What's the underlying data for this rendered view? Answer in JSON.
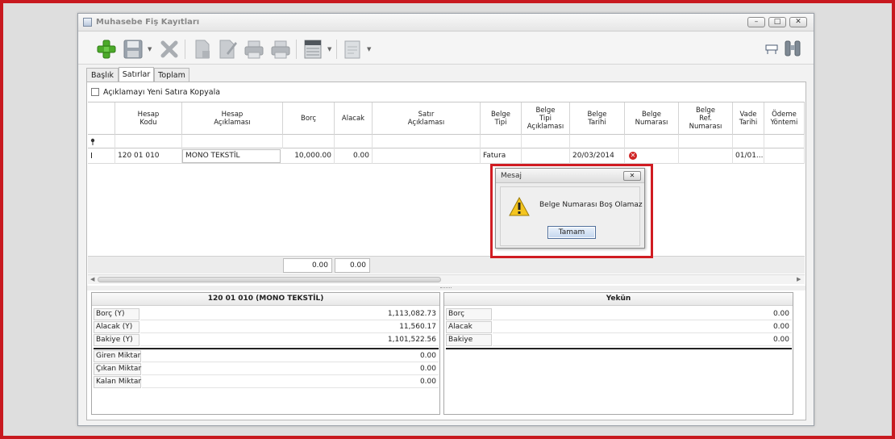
{
  "window": {
    "title": "Muhasebe Fiş Kayıtları"
  },
  "titlebar_buttons": [
    "–",
    "□",
    "✕"
  ],
  "tabs": [
    {
      "label": "Başlık",
      "active": false
    },
    {
      "label": "Satırlar",
      "active": true
    },
    {
      "label": "Toplam",
      "active": false
    }
  ],
  "copy_checkbox": {
    "label": "Açıklamayı Yeni Satıra Kopyala",
    "checked": false
  },
  "grid": {
    "columns": [
      {
        "key": "hesap_kodu",
        "label": "Hesap\nKodu"
      },
      {
        "key": "hesap_aciklamasi",
        "label": "Hesap\nAçıklaması"
      },
      {
        "key": "borc",
        "label": "Borç"
      },
      {
        "key": "alacak",
        "label": "Alacak"
      },
      {
        "key": "satir_aciklamasi",
        "label": "Satır\nAçıklaması"
      },
      {
        "key": "belge_tipi",
        "label": "Belge\nTipi"
      },
      {
        "key": "belge_tipi_aciklamasi",
        "label": "Belge\nTipi\nAçıklaması"
      },
      {
        "key": "belge_tarihi",
        "label": "Belge\nTarihi"
      },
      {
        "key": "belge_numarasi",
        "label": "Belge\nNumarası"
      },
      {
        "key": "belge_ref_numarasi",
        "label": "Belge\nRef.\nNumarası"
      },
      {
        "key": "vade_tarihi",
        "label": "Vade\nTarihi"
      },
      {
        "key": "odeme_yontemi",
        "label": "Ödeme\nYöntemi"
      }
    ],
    "rows": [
      {
        "hesap_kodu": "120 01 010",
        "hesap_aciklamasi": "MONO TEKSTİL",
        "borc": "10,000.00",
        "alacak": "0.00",
        "satir_aciklamasi": "",
        "belge_tipi": "Fatura",
        "belge_tipi_aciklamasi": "",
        "belge_tarihi": "20/03/2014",
        "belge_numarasi": "",
        "belge_ref_numarasi": "",
        "vade_tarihi": "01/01...",
        "odeme_yontemi": ""
      }
    ],
    "totals": {
      "borc": "0.00",
      "alacak": "0.00"
    }
  },
  "account_panel": {
    "title": "120 01 010 (MONO TEKSTİL)",
    "rows": [
      {
        "label": "Borç (Y)",
        "value": "1,113,082.73"
      },
      {
        "label": "Alacak (Y)",
        "value": "11,560.17"
      },
      {
        "label": "Bakiye (Y)",
        "value": "1,101,522.56"
      }
    ],
    "quantity_rows": [
      {
        "label": "Giren Miktar",
        "value": "0.00"
      },
      {
        "label": "Çıkan Miktar",
        "value": "0.00"
      },
      {
        "label": "Kalan Miktar",
        "value": "0.00"
      }
    ]
  },
  "total_panel": {
    "title": "Yekün",
    "rows": [
      {
        "label": "Borç",
        "value": "0.00"
      },
      {
        "label": "Alacak",
        "value": "0.00"
      },
      {
        "label": "Bakiye",
        "value": "0.00"
      }
    ]
  },
  "dialog": {
    "title": "Mesaj",
    "message": "Belge Numarası Boş Olamaz",
    "ok_label": "Tamam",
    "close_glyph": "✕"
  },
  "icons": {
    "add": "plus-icon",
    "save": "floppy-disk-icon",
    "delete": "x-icon",
    "new_doc": "document-icon",
    "edit_doc": "edit-document-icon",
    "print_preview": "printer-icon",
    "print": "printer-icon",
    "export": "spreadsheet-icon",
    "template": "template-icon",
    "layout": "layout-icon",
    "search": "binoculars-icon",
    "warning": "warning-icon",
    "error": "error-icon"
  },
  "colors": {
    "highlight": "#d01c22",
    "add_green": "#4caa2a"
  }
}
